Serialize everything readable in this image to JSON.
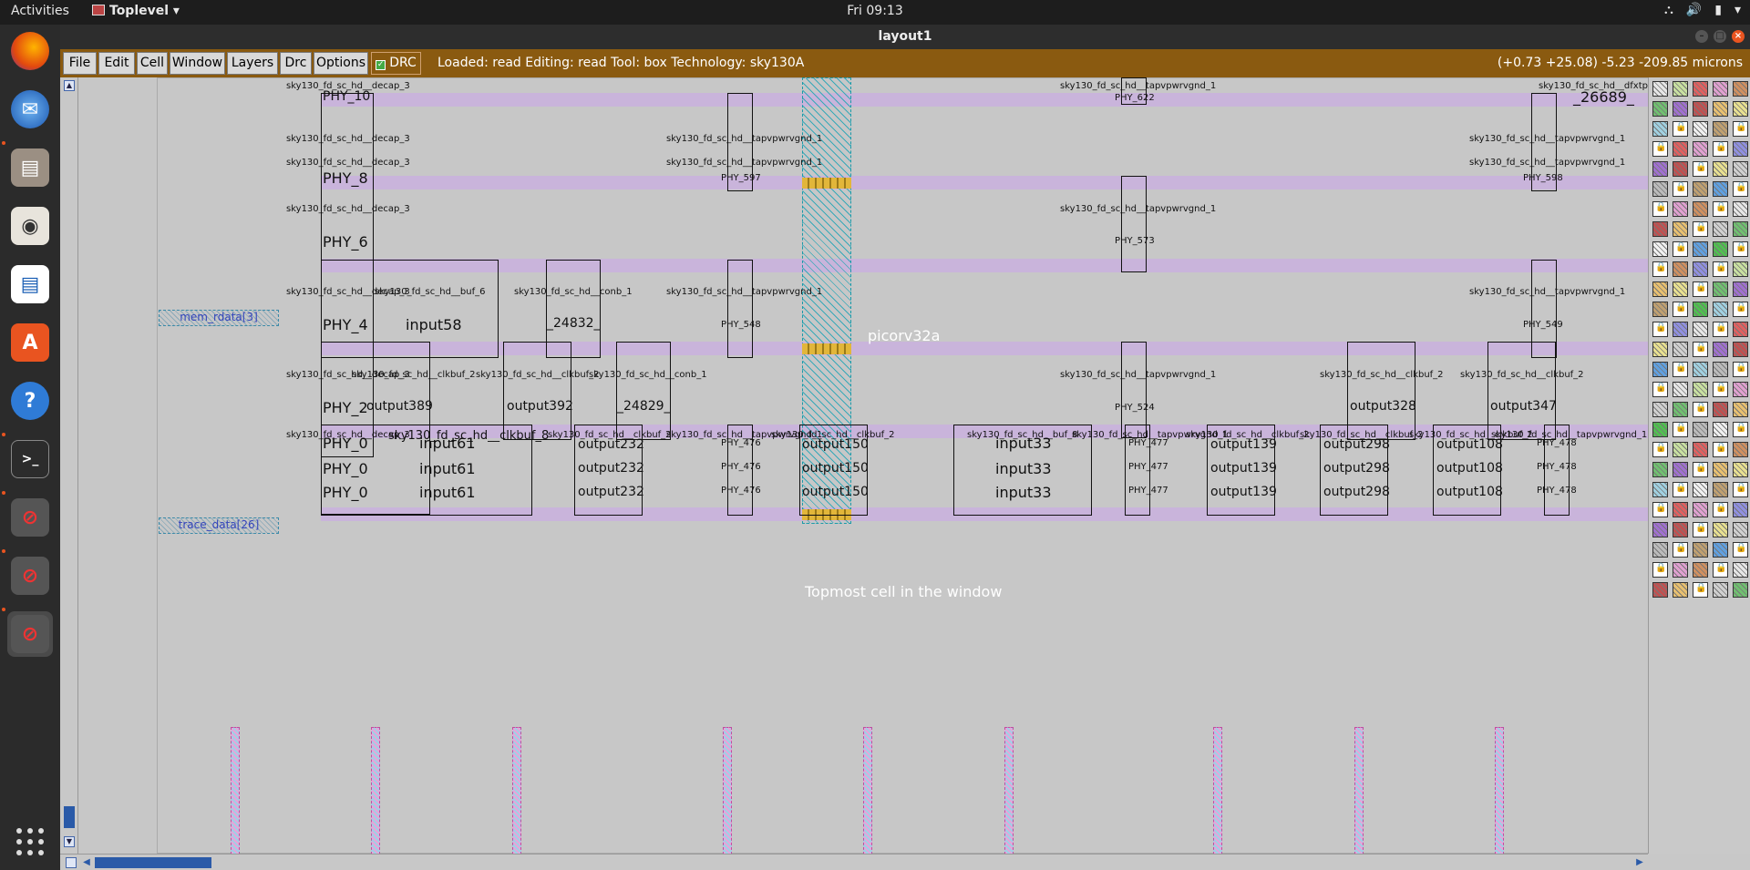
{
  "topbar": {
    "activities": "Activities",
    "app_name": "Toplevel",
    "clock": "Fri 09:13"
  },
  "window": {
    "title": "layout1"
  },
  "menu": {
    "file": "File",
    "edit": "Edit",
    "cell": "Cell",
    "window": "Window",
    "layers": "Layers",
    "drc": "Drc",
    "options": "Options",
    "drc_toggle": "DRC"
  },
  "status": "Loaded: read Editing: read Tool: box  Technology: sky130A",
  "coords": "(+0.73 +25.08) -5.23 -209.85 microns",
  "layout": {
    "top_cell": "picorv32a",
    "topmost_msg": "Topmost cell in the window",
    "pins": [
      "mem_rdata[3]",
      "trace_data[26]"
    ],
    "cells": [
      "sky130_fd_sc_hd__decap_3",
      "sky130_fd_sc_hd__tapvpwrvgnd_1",
      "sky130_fd_sc_hd__dfxtp",
      "sky130_fd_sc_hd__buf_6",
      "sky130_fd_sc_hd__conb_1",
      "sky130_fd_sc_hd__clkbuf_2",
      "sky130_fd_sc_hd__clkbuf_8",
      "sky130_fd_sc_hd__buf_8"
    ],
    "instances": {
      "phy_10": "PHY_10",
      "phy_8": "PHY_8",
      "phy_6": "PHY_6",
      "phy_4": "PHY_4",
      "phy_2": "PHY_2",
      "phy_0": "PHY_0",
      "phy_622": "PHY_622",
      "phy_597": "PHY_597",
      "phy_598": "PHY_598",
      "phy_573": "PHY_573",
      "phy_548": "PHY_548",
      "phy_549": "PHY_549",
      "phy_524": "PHY_524",
      "phy_476": "PHY_476",
      "phy_477": "PHY_477",
      "phy_478": "PHY_478",
      "n26689": "_26689_",
      "n24832": "_24832_",
      "n24829": "_24829_",
      "input58": "input58",
      "input61": "input61",
      "input33": "input33",
      "output389": "output389",
      "output392": "output392",
      "output328": "output328",
      "output347": "output347",
      "output232": "output232",
      "output150": "output150",
      "output139": "output139",
      "output298": "output298",
      "output108": "output108"
    }
  },
  "colors": {
    "menubar": "#8a5a10",
    "rail": "#c9b4db",
    "topbar": "#1d1d1d",
    "dock": "#2b2b2b",
    "canvas": "#c7c7c7"
  },
  "dock_icons": [
    "firefox-icon",
    "thunderbird-icon",
    "files-icon",
    "rhythmbox-icon",
    "writer-icon",
    "software-icon",
    "help-icon",
    "terminal-icon",
    "blocked-app-icon",
    "blocked-app-icon",
    "blocked-app-icon",
    "show-apps-icon"
  ]
}
